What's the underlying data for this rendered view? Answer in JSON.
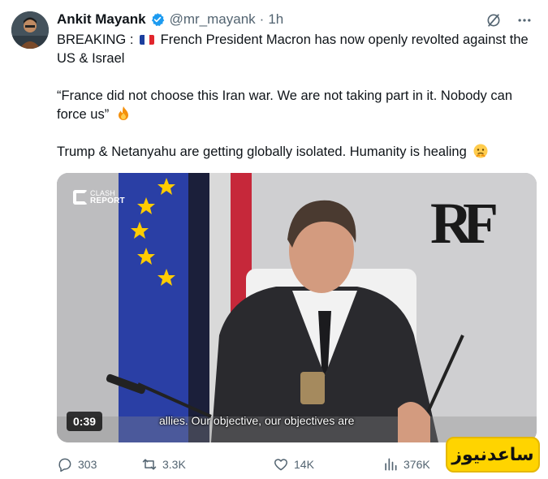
{
  "author": {
    "name": "Ankit Mayank",
    "handle": "@mr_mayank",
    "separator": "·",
    "time": "1h",
    "verified": true
  },
  "icons": {
    "avatar": "avatar-image",
    "verified": "verified-badge-icon",
    "grok": "grok-icon",
    "more": "more-icon",
    "flag": "france-flag-icon",
    "fire": "fire-emoji-icon",
    "face": "face-holding-tears-emoji-icon",
    "reply": "reply-icon",
    "retweet": "retweet-icon",
    "like": "heart-icon",
    "views": "views-chart-icon"
  },
  "tweet": {
    "line1_prefix": "BREAKING :",
    "line1_suffix": "French President Macron has now openly revolted against the US & Israel",
    "quote": "“France did not choose this Iran war. We are not taking part in it. Nobody can force us”",
    "closing": "Trump & Netanyahu are getting globally isolated. Humanity is healing"
  },
  "media": {
    "watermark_top": "CLASH",
    "watermark_bottom": "REPORT",
    "monogram": "RF",
    "duration": "0:39",
    "subtitle": "allies.  Our objective, our objectives are"
  },
  "actions": {
    "replies": "303",
    "retweets": "3.3K",
    "likes": "14K",
    "views": "376K"
  },
  "overlay": {
    "site_badge": "ساعدنیوز"
  },
  "colors": {
    "verified_blue": "#1d9bf0",
    "secondary_text": "#536471",
    "badge_yellow": "#ffd400"
  }
}
